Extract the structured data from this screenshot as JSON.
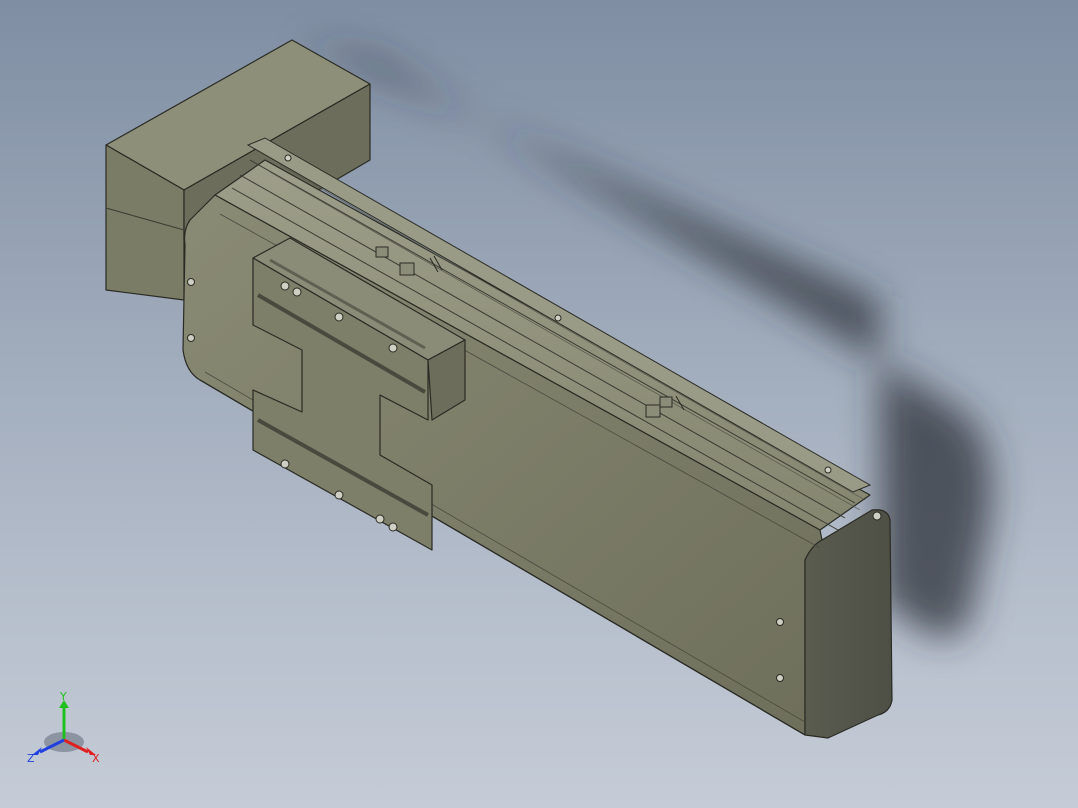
{
  "viewport": {
    "background_top": "#7f8ea3",
    "background_bottom": "#c5ccd7"
  },
  "model": {
    "body_color": "#7b7c66",
    "dark_color": "#56574a",
    "light_color": "#9a9b86",
    "edge_color": "#2a2b24",
    "shadow_color": "#3b4048"
  },
  "triad": {
    "x_label": "X",
    "y_label": "Y",
    "z_label": "Z",
    "x_color": "#e02020",
    "y_color": "#20c020",
    "z_color": "#2040e0"
  }
}
